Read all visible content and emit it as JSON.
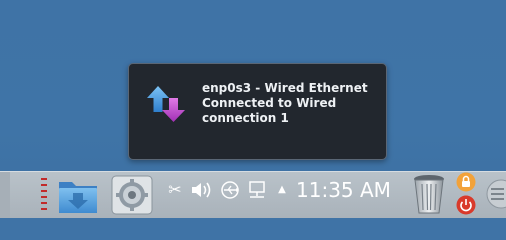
{
  "notification": {
    "title": "enp0s3 - Wired Ethernet",
    "line2": "Connected to Wired",
    "line3": "connection 1",
    "icon": "network-transfer-arrows-icon"
  },
  "panel": {
    "clock": "11:35 AM",
    "icons": [
      "folder-download-icon",
      "settings-icon",
      "scissors-icon",
      "volume-icon",
      "usb-icon",
      "network-icon",
      "tray-expand-icon",
      "trash-icon",
      "lock-icon",
      "power-icon",
      "menu-icon"
    ]
  },
  "colors": {
    "desktop": "#3f73a6",
    "panel": "#b4bdc4",
    "notification_bg": "#22272e",
    "arrow_blue": "#3b8fd9",
    "arrow_magenta": "#b13fc0"
  }
}
